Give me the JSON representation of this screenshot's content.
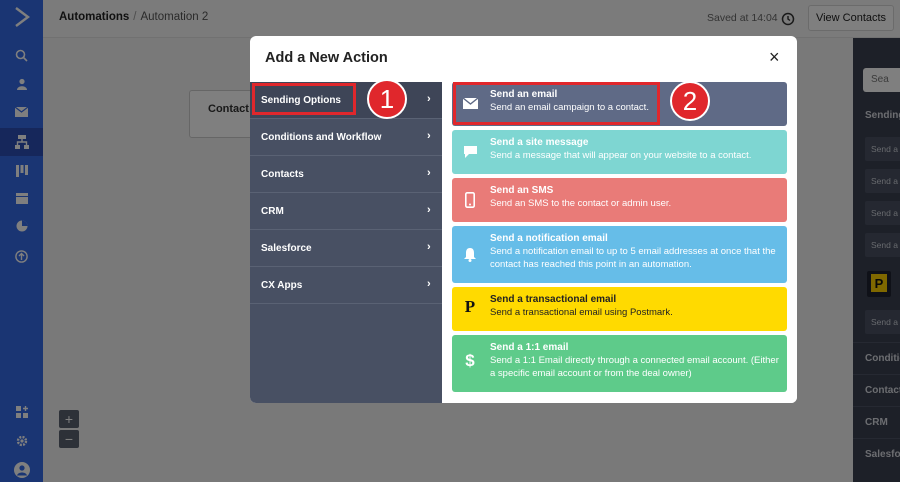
{
  "breadcrumb": {
    "root": "Automations",
    "separator": "/",
    "current": "Automation 2"
  },
  "header": {
    "saved_text": "Saved at 14:04",
    "view_contacts": "View Contacts"
  },
  "canvas": {
    "trigger_label": "Contact tr",
    "zoom_in": "+",
    "zoom_out": "−"
  },
  "right_panel": {
    "search_placeholder": "Sea",
    "section_title": "Sending",
    "items": [
      "Send a",
      "Send a",
      "Send a",
      "Send a",
      "Send a"
    ],
    "postmark_glyph": "P",
    "sections": [
      "Conditio",
      "Contact",
      "CRM",
      "Salesfor"
    ]
  },
  "modal": {
    "title": "Add a New Action",
    "close": "×",
    "categories": [
      {
        "label": "Sending Options"
      },
      {
        "label": "Conditions and Workflow"
      },
      {
        "label": "Contacts"
      },
      {
        "label": "CRM"
      },
      {
        "label": "Salesforce"
      },
      {
        "label": "CX Apps"
      }
    ],
    "chevron": "›",
    "actions": [
      {
        "title": "Send an email",
        "desc": "Send an email campaign to a contact.",
        "color": "#5f6a86",
        "icon": "envelope-icon"
      },
      {
        "title": "Send a site message",
        "desc": "Send a message that will appear on your website to a contact.",
        "color": "#7ed6d2",
        "icon": "chat-bubble-icon"
      },
      {
        "title": "Send an SMS",
        "desc": "Send an SMS to the contact or admin user.",
        "color": "#e97b78",
        "icon": "phone-icon"
      },
      {
        "title": "Send a notification email",
        "desc": "Send a notification email to up to 5 email addresses at once that the contact has reached this point in an automation.",
        "color": "#66bde8",
        "icon": "bell-icon"
      },
      {
        "title": "Send a transactional email",
        "desc": "Send a transactional email using Postmark.",
        "color": "#ffda00",
        "icon": "postmark-icon",
        "glyph": "P"
      },
      {
        "title": "Send a 1:1 email",
        "desc": "Send a 1:1 Email directly through a connected email account. (Either a specific email account or from the deal owner)",
        "color": "#5ecb8a",
        "icon": "dollar-icon",
        "glyph": "$"
      }
    ]
  },
  "annotations": {
    "step1": "1",
    "step2": "2",
    "highlight_color": "#e0272c"
  }
}
